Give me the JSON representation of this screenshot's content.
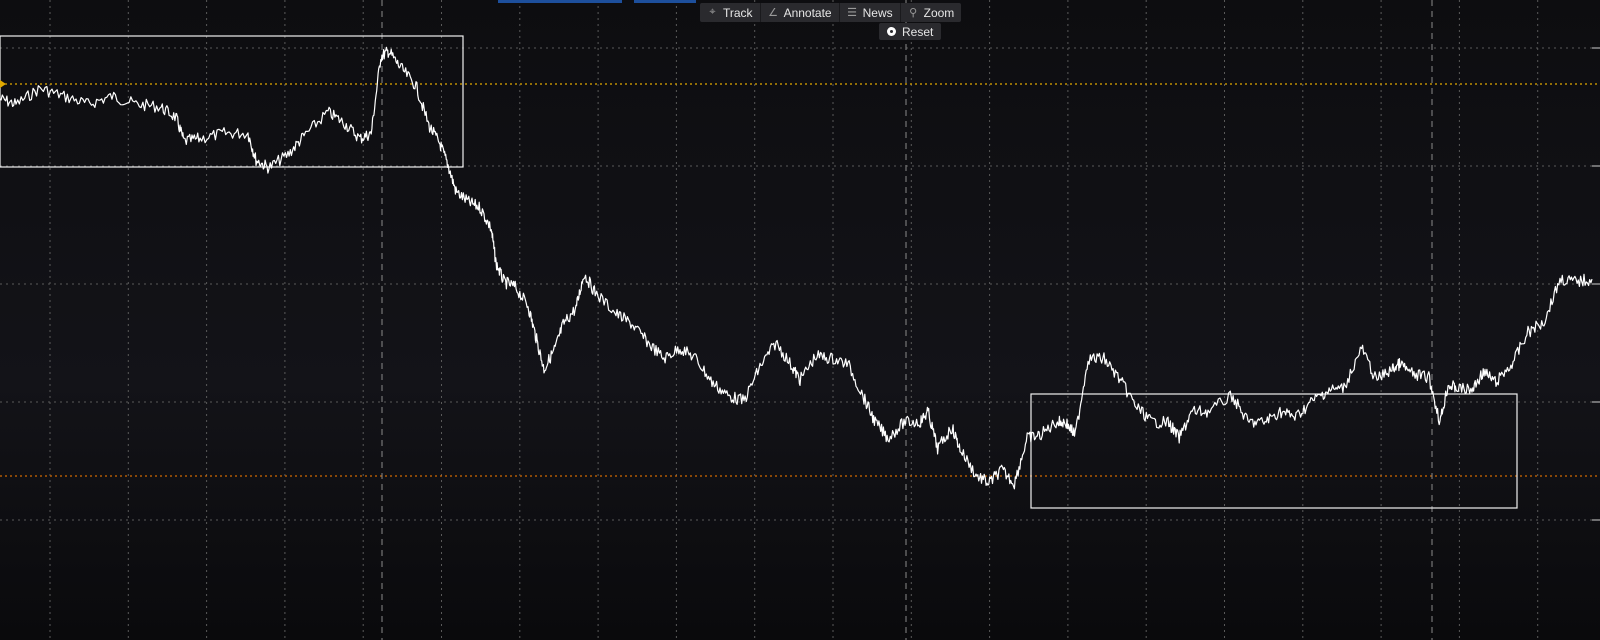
{
  "toolbar": {
    "items": [
      {
        "label": "Track",
        "icon": "crosshair-icon"
      },
      {
        "label": "Annotate",
        "icon": "pencil-icon"
      },
      {
        "label": "News",
        "icon": "list-icon"
      },
      {
        "label": "Zoom",
        "icon": "magnifier-icon"
      }
    ],
    "reset_label": "Reset",
    "reset_icon": "radio-icon"
  },
  "colors": {
    "background": "#0d0d10",
    "line": "#ffffff",
    "grid": "#6a6a6a",
    "upper_level": "#e0a800",
    "lower_level": "#d26a00",
    "tab_accent": "#1d4f9c"
  },
  "chart_data": {
    "type": "line",
    "grid": true,
    "xlim": [
      0,
      1
    ],
    "ylim": [
      0,
      1
    ],
    "series": [
      {
        "points": [
          [
            0.0,
            0.13
          ],
          [
            0.01,
            0.14
          ],
          [
            0.025,
            0.11
          ],
          [
            0.04,
            0.125
          ],
          [
            0.055,
            0.14
          ],
          [
            0.07,
            0.125
          ],
          [
            0.085,
            0.14
          ],
          [
            0.1,
            0.145
          ],
          [
            0.11,
            0.165
          ],
          [
            0.115,
            0.21
          ],
          [
            0.125,
            0.205
          ],
          [
            0.14,
            0.195
          ],
          [
            0.155,
            0.195
          ],
          [
            0.16,
            0.245
          ],
          [
            0.168,
            0.26
          ],
          [
            0.18,
            0.235
          ],
          [
            0.19,
            0.2
          ],
          [
            0.205,
            0.155
          ],
          [
            0.215,
            0.175
          ],
          [
            0.225,
            0.205
          ],
          [
            0.232,
            0.195
          ],
          [
            0.238,
            0.05
          ],
          [
            0.243,
            0.04
          ],
          [
            0.25,
            0.07
          ],
          [
            0.26,
            0.105
          ],
          [
            0.268,
            0.18
          ],
          [
            0.275,
            0.215
          ],
          [
            0.28,
            0.255
          ],
          [
            0.285,
            0.305
          ],
          [
            0.293,
            0.325
          ],
          [
            0.3,
            0.335
          ],
          [
            0.307,
            0.375
          ],
          [
            0.31,
            0.44
          ],
          [
            0.315,
            0.475
          ],
          [
            0.322,
            0.485
          ],
          [
            0.33,
            0.52
          ],
          [
            0.335,
            0.58
          ],
          [
            0.34,
            0.64
          ],
          [
            0.347,
            0.6
          ],
          [
            0.352,
            0.555
          ],
          [
            0.36,
            0.525
          ],
          [
            0.365,
            0.46
          ],
          [
            0.372,
            0.495
          ],
          [
            0.385,
            0.535
          ],
          [
            0.395,
            0.555
          ],
          [
            0.405,
            0.59
          ],
          [
            0.415,
            0.62
          ],
          [
            0.425,
            0.6
          ],
          [
            0.435,
            0.62
          ],
          [
            0.445,
            0.665
          ],
          [
            0.455,
            0.69
          ],
          [
            0.465,
            0.7
          ],
          [
            0.475,
            0.635
          ],
          [
            0.485,
            0.59
          ],
          [
            0.495,
            0.635
          ],
          [
            0.5,
            0.66
          ],
          [
            0.51,
            0.615
          ],
          [
            0.52,
            0.62
          ],
          [
            0.53,
            0.63
          ],
          [
            0.54,
            0.695
          ],
          [
            0.547,
            0.74
          ],
          [
            0.555,
            0.77
          ],
          [
            0.565,
            0.74
          ],
          [
            0.575,
            0.74
          ],
          [
            0.58,
            0.72
          ],
          [
            0.586,
            0.79
          ],
          [
            0.595,
            0.75
          ],
          [
            0.6,
            0.79
          ],
          [
            0.61,
            0.84
          ],
          [
            0.618,
            0.855
          ],
          [
            0.626,
            0.83
          ],
          [
            0.634,
            0.855
          ],
          [
            0.642,
            0.77
          ],
          [
            0.65,
            0.765
          ],
          [
            0.66,
            0.74
          ],
          [
            0.666,
            0.74
          ],
          [
            0.672,
            0.765
          ],
          [
            0.68,
            0.62
          ],
          [
            0.69,
            0.62
          ],
          [
            0.7,
            0.66
          ],
          [
            0.71,
            0.71
          ],
          [
            0.72,
            0.74
          ],
          [
            0.73,
            0.74
          ],
          [
            0.737,
            0.77
          ],
          [
            0.745,
            0.72
          ],
          [
            0.755,
            0.72
          ],
          [
            0.77,
            0.69
          ],
          [
            0.78,
            0.74
          ],
          [
            0.79,
            0.74
          ],
          [
            0.8,
            0.72
          ],
          [
            0.81,
            0.73
          ],
          [
            0.82,
            0.7
          ],
          [
            0.83,
            0.68
          ],
          [
            0.84,
            0.675
          ],
          [
            0.851,
            0.6
          ],
          [
            0.86,
            0.66
          ],
          [
            0.87,
            0.64
          ],
          [
            0.875,
            0.63
          ],
          [
            0.883,
            0.65
          ],
          [
            0.893,
            0.655
          ],
          [
            0.9,
            0.74
          ],
          [
            0.905,
            0.67
          ],
          [
            0.91,
            0.675
          ],
          [
            0.92,
            0.68
          ],
          [
            0.927,
            0.645
          ],
          [
            0.935,
            0.665
          ],
          [
            0.945,
            0.63
          ],
          [
            0.955,
            0.57
          ],
          [
            0.965,
            0.55
          ],
          [
            0.975,
            0.47
          ],
          [
            0.985,
            0.475
          ],
          [
            0.995,
            0.47
          ]
        ]
      }
    ]
  }
}
